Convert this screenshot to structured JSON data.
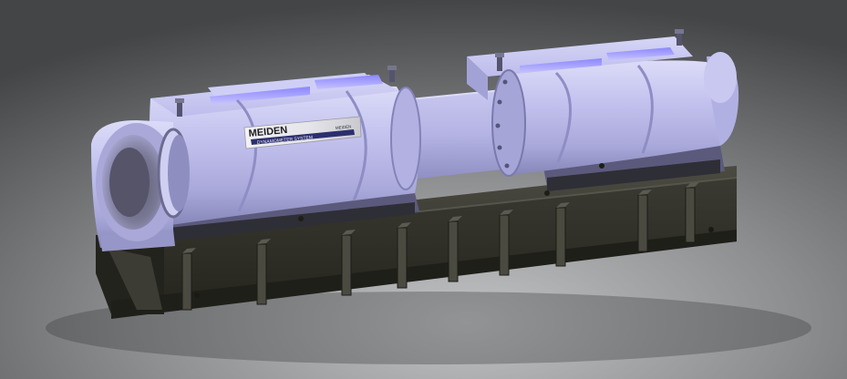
{
  "plate": {
    "brand": "MEIDEN",
    "subtitle": "DYNAMOMETER SYSTEM",
    "model": "MEIDEN"
  },
  "colors": {
    "background_top": "#4a4b4d",
    "background_bottom": "#a7a8aa",
    "housing": "#b9b8e8",
    "housing_shadow": "#8c8bc4",
    "base": "#2d2d27",
    "base_highlight": "#45453d"
  }
}
